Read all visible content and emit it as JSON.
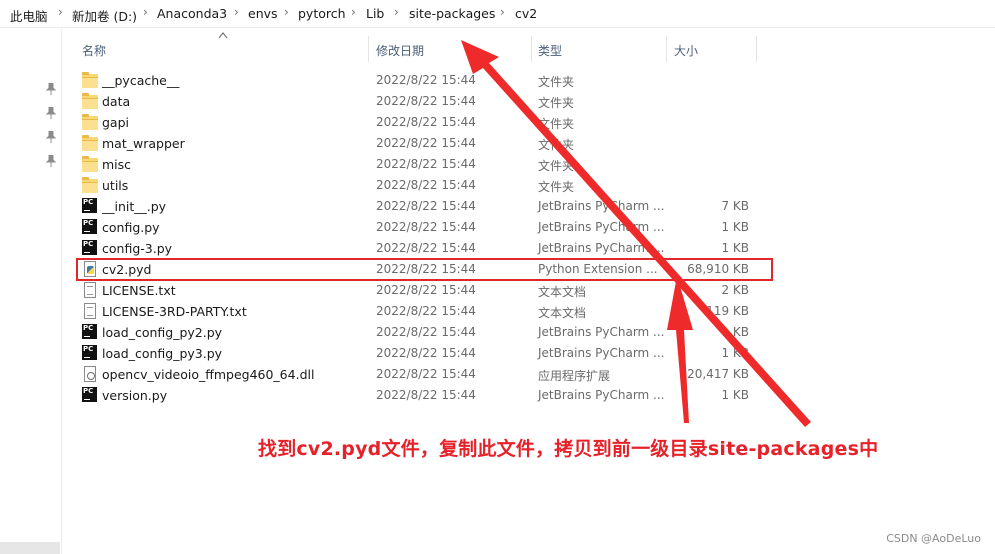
{
  "breadcrumb": [
    "此电脑",
    "新加卷 (D:)",
    "Anaconda3",
    "envs",
    "pytorch",
    "Lib",
    "site-packages",
    "cv2"
  ],
  "columns": {
    "name": "名称",
    "date": "修改日期",
    "type": "类型",
    "size": "大小"
  },
  "rows": [
    {
      "icon": "folder-icon",
      "name": "__pycache__",
      "date": "2022/8/22 15:44",
      "type": "文件夹",
      "size": ""
    },
    {
      "icon": "folder-icon",
      "name": "data",
      "date": "2022/8/22 15:44",
      "type": "文件夹",
      "size": ""
    },
    {
      "icon": "folder-icon",
      "name": "gapi",
      "date": "2022/8/22 15:44",
      "type": "文件夹",
      "size": ""
    },
    {
      "icon": "folder-icon",
      "name": "mat_wrapper",
      "date": "2022/8/22 15:44",
      "type": "文件夹",
      "size": ""
    },
    {
      "icon": "folder-icon",
      "name": "misc",
      "date": "2022/8/22 15:44",
      "type": "文件夹",
      "size": ""
    },
    {
      "icon": "folder-icon",
      "name": "utils",
      "date": "2022/8/22 15:44",
      "type": "文件夹",
      "size": ""
    },
    {
      "icon": "pycharm-file-icon",
      "name": "__init__.py",
      "date": "2022/8/22 15:44",
      "type": "JetBrains PyCharm ...",
      "size": "7 KB"
    },
    {
      "icon": "pycharm-file-icon",
      "name": "config.py",
      "date": "2022/8/22 15:44",
      "type": "JetBrains PyCharm ...",
      "size": "1 KB"
    },
    {
      "icon": "pycharm-file-icon",
      "name": "config-3.py",
      "date": "2022/8/22 15:44",
      "type": "JetBrains PyCharm ...",
      "size": "1 KB"
    },
    {
      "icon": "python-extension-icon",
      "name": "cv2.pyd",
      "date": "2022/8/22 15:44",
      "type": "Python Extension ...",
      "size": "68,910 KB"
    },
    {
      "icon": "text-file-icon",
      "name": "LICENSE.txt",
      "date": "2022/8/22 15:44",
      "type": "文本文档",
      "size": "2 KB"
    },
    {
      "icon": "text-file-icon",
      "name": "LICENSE-3RD-PARTY.txt",
      "date": "2022/8/22 15:44",
      "type": "文本文档",
      "size": "119 KB"
    },
    {
      "icon": "pycharm-file-icon",
      "name": "load_config_py2.py",
      "date": "2022/8/22 15:44",
      "type": "JetBrains PyCharm ...",
      "size": "1 KB"
    },
    {
      "icon": "pycharm-file-icon",
      "name": "load_config_py3.py",
      "date": "2022/8/22 15:44",
      "type": "JetBrains PyCharm ...",
      "size": "1 KB"
    },
    {
      "icon": "dll-file-icon",
      "name": "opencv_videoio_ffmpeg460_64.dll",
      "date": "2022/8/22 15:44",
      "type": "应用程序扩展",
      "size": "20,417 KB"
    },
    {
      "icon": "pycharm-file-icon",
      "name": "version.py",
      "date": "2022/8/22 15:44",
      "type": "JetBrains PyCharm ...",
      "size": "1 KB"
    }
  ],
  "annotation": "找到cv2.pyd文件，复制此文件，拷贝到前一级目录site-packages中",
  "watermark": "CSDN @AoDeLuo",
  "colors": {
    "highlight": "#e0282c",
    "annotation": "#e62129",
    "arrow": "#ee2a2a"
  }
}
